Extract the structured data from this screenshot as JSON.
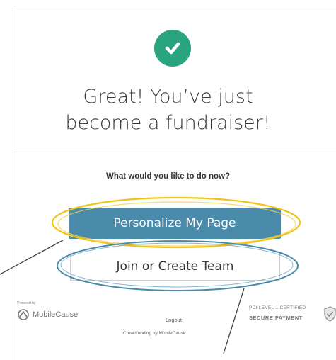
{
  "headline": {
    "line1": "Great! You’ve just",
    "line2": "become a fundraiser!"
  },
  "prompt": "What would you like to do now?",
  "buttons": {
    "primary": "Personalize My Page",
    "secondary": "Join or Create Team"
  },
  "footer": {
    "powered_by": "Powered by",
    "brand": "MobileCause",
    "logout": "Logout",
    "crowdfunding": "Crowdfunding by MobileCause",
    "pci_line1": "PCI LEVEL 1 CERTIFIED",
    "pci_line2": "SECURE PAYMENT"
  },
  "colors": {
    "success_check": "#2aa37f",
    "primary_button": "#4a8bab",
    "highlight_yellow": "#f0c419",
    "highlight_blue": "#4a8bab"
  },
  "icons": [
    "check-circle-icon",
    "mobilecause-logo-icon",
    "shield-icon"
  ]
}
